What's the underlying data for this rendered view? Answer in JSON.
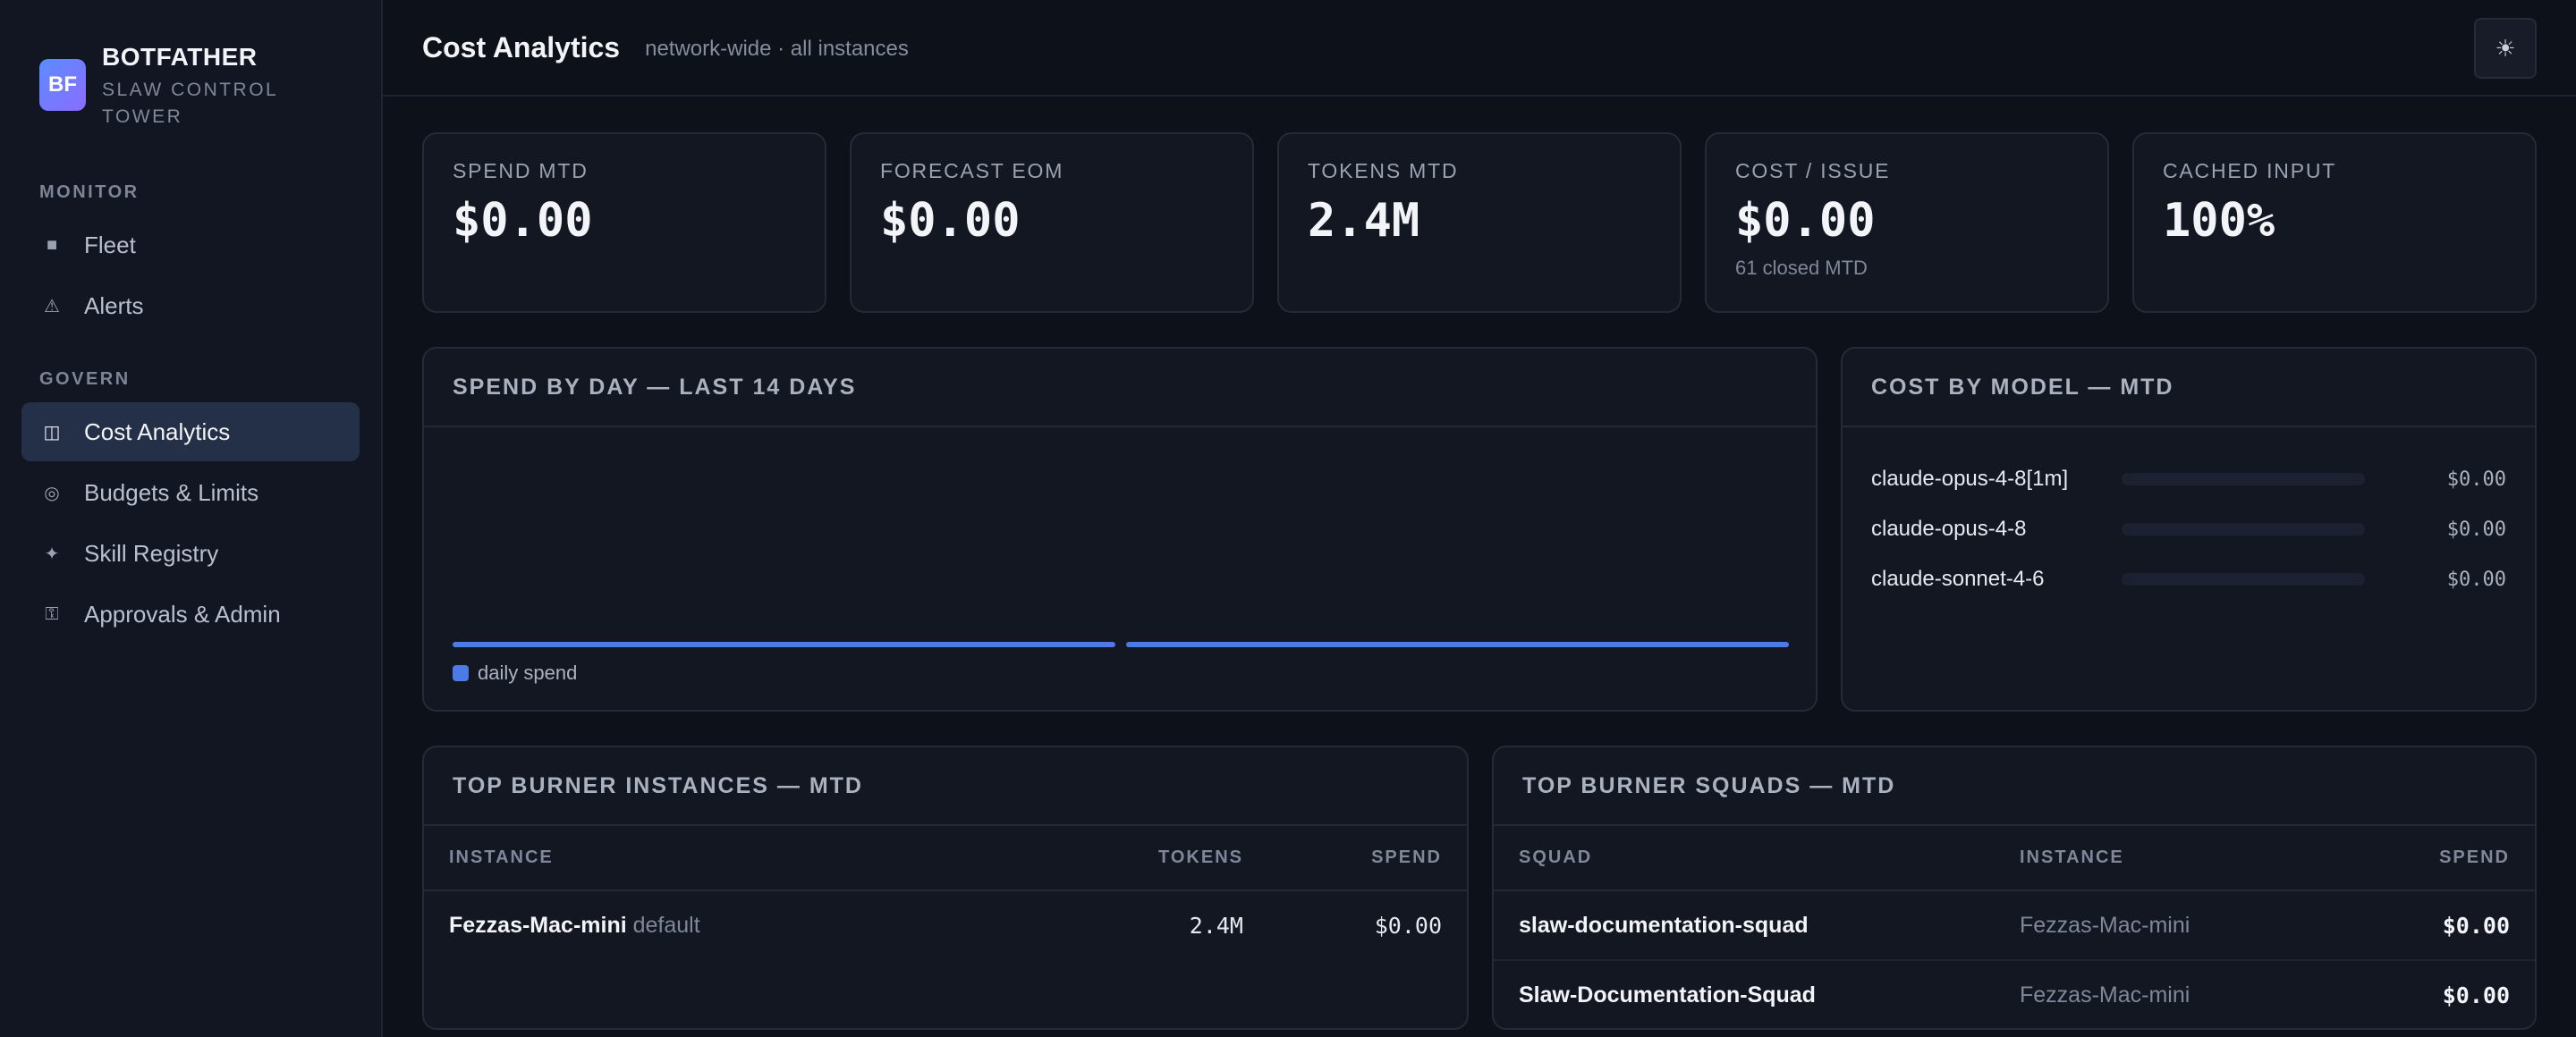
{
  "brand": {
    "logo": "BF",
    "name": "BOTFATHER",
    "subtitle": "SLAW CONTROL TOWER"
  },
  "nav": {
    "sections": [
      {
        "label": "MONITOR",
        "items": [
          {
            "label": "Fleet",
            "icon": "square-icon"
          },
          {
            "label": "Alerts",
            "icon": "warning-icon"
          }
        ]
      },
      {
        "label": "GOVERN",
        "items": [
          {
            "label": "Cost Analytics",
            "icon": "columns-icon",
            "active": true
          },
          {
            "label": "Budgets & Limits",
            "icon": "target-icon"
          },
          {
            "label": "Skill Registry",
            "icon": "sparkle-icon"
          },
          {
            "label": "Approvals & Admin",
            "icon": "key-icon"
          }
        ]
      }
    ]
  },
  "header": {
    "title": "Cost Analytics",
    "subtitle": "network-wide · all instances",
    "theme_toggle_icon": "sun-icon"
  },
  "kpis": [
    {
      "label": "SPEND MTD",
      "value": "$0.00",
      "note": ""
    },
    {
      "label": "FORECAST EOM",
      "value": "$0.00",
      "note": ""
    },
    {
      "label": "TOKENS MTD",
      "value": "2.4M",
      "note": ""
    },
    {
      "label": "COST / ISSUE",
      "value": "$0.00",
      "note": "61 closed MTD"
    },
    {
      "label": "CACHED INPUT",
      "value": "100%",
      "note": ""
    }
  ],
  "spend_by_day": {
    "title": "SPEND BY DAY — LAST 14 DAYS",
    "legend": "daily spend",
    "color": "#4c7be8"
  },
  "chart_data": {
    "type": "bar",
    "title": "SPEND BY DAY — LAST 14 DAYS",
    "categories": [
      "",
      ""
    ],
    "series": [
      {
        "name": "daily spend",
        "values": [
          0,
          0
        ]
      }
    ],
    "xlabel": "",
    "ylabel": "",
    "grid": false,
    "legend": "bottom-left"
  },
  "cost_by_model": {
    "title": "COST BY MODEL — MTD",
    "rows": [
      {
        "model": "claude-opus-4-8[1m]",
        "value": "$0.00",
        "fraction": 0
      },
      {
        "model": "claude-opus-4-8",
        "value": "$0.00",
        "fraction": 0
      },
      {
        "model": "claude-sonnet-4-6",
        "value": "$0.00",
        "fraction": 0
      }
    ]
  },
  "top_burner_instances": {
    "title": "TOP BURNER INSTANCES — MTD",
    "columns": [
      "INSTANCE",
      "TOKENS",
      "SPEND"
    ],
    "rows": [
      {
        "instance": "Fezzas-Mac-mini",
        "tag": "default",
        "tokens": "2.4M",
        "spend": "$0.00"
      }
    ]
  },
  "top_burner_squads": {
    "title": "TOP BURNER SQUADS — MTD",
    "columns": [
      "SQUAD",
      "INSTANCE",
      "SPEND"
    ],
    "rows": [
      {
        "squad": "slaw-documentation-squad",
        "instance": "Fezzas-Mac-mini",
        "spend": "$0.00"
      },
      {
        "squad": "Slaw-Documentation-Squad",
        "instance": "Fezzas-Mac-mini",
        "spend": "$0.00"
      }
    ]
  }
}
